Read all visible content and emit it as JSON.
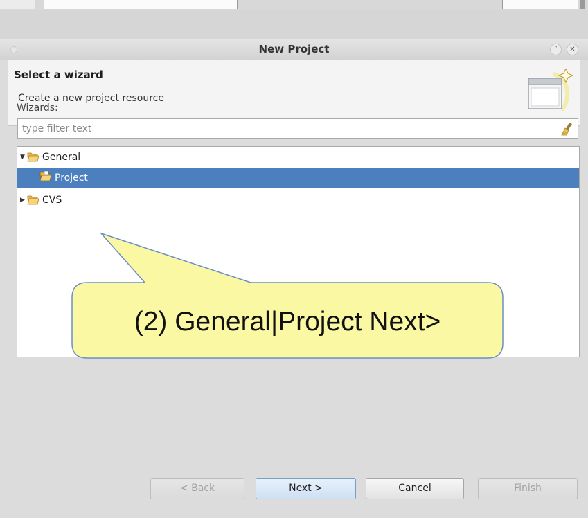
{
  "dialog": {
    "title": "New Project"
  },
  "header": {
    "title": "Select a wizard",
    "subtitle": "Create a new project resource",
    "icon": "new-wizard-icon"
  },
  "wizards": {
    "label": "Wizards:",
    "filter_placeholder": "type filter text",
    "tree": [
      {
        "label": "General",
        "expanded": true,
        "icon": "folder-open-icon"
      },
      {
        "label": "Project",
        "selected": true,
        "icon": "project-folder-icon"
      },
      {
        "label": "CVS",
        "expanded": false,
        "icon": "folder-open-icon"
      }
    ]
  },
  "callout": {
    "text": "(2) General|Project Next>"
  },
  "buttons": {
    "back": "< Back",
    "next": "Next >",
    "cancel": "Cancel",
    "finish": "Finish"
  },
  "colors": {
    "selection": "#4b7fbe",
    "callout_fill": "#fbf8a4",
    "callout_stroke": "#6b8fc3"
  }
}
